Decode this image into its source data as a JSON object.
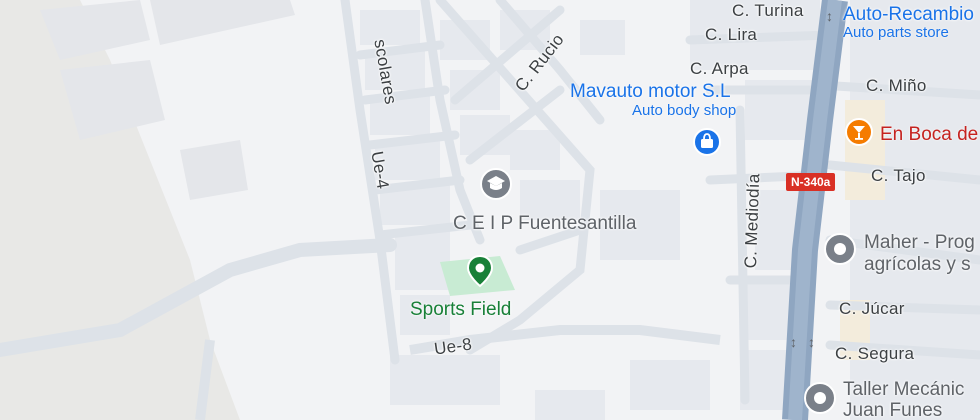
{
  "streets": {
    "escolares": "scolares",
    "rucio": "C. Rucio",
    "ue4": "Ue-4",
    "ue8": "Ue-8",
    "turina": "C. Turina",
    "lira": "C. Lira",
    "arpa": "C. Arpa",
    "mino": "C. Miño",
    "tajo": "C. Tajo",
    "mediodia": "C. Mediodía",
    "jucar": "C. Júcar",
    "segura": "C. Segura"
  },
  "road": {
    "shield": "N-340a"
  },
  "pois": {
    "recambios_name": "Auto-Recambio",
    "recambios_type": "Auto parts store",
    "mavauto_name": "Mavauto motor S.L",
    "mavauto_type": "Auto body shop",
    "boca_name": "En Boca de",
    "ceip_name": "C E I P Fuentesantilla",
    "sports_name": "Sports Field",
    "maher_line1": "Maher - Prog",
    "maher_line2": "agrícolas y s",
    "taller_line1": "Taller Mecánic",
    "taller_line2": "Juan Funes"
  },
  "colors": {
    "road_main": "#8fa6c1",
    "road_minor": "#dfe3e8",
    "park": "#c8ebd3",
    "accent_blue": "#1a73e8",
    "accent_green": "#188038",
    "accent_orange": "#f57c00"
  }
}
